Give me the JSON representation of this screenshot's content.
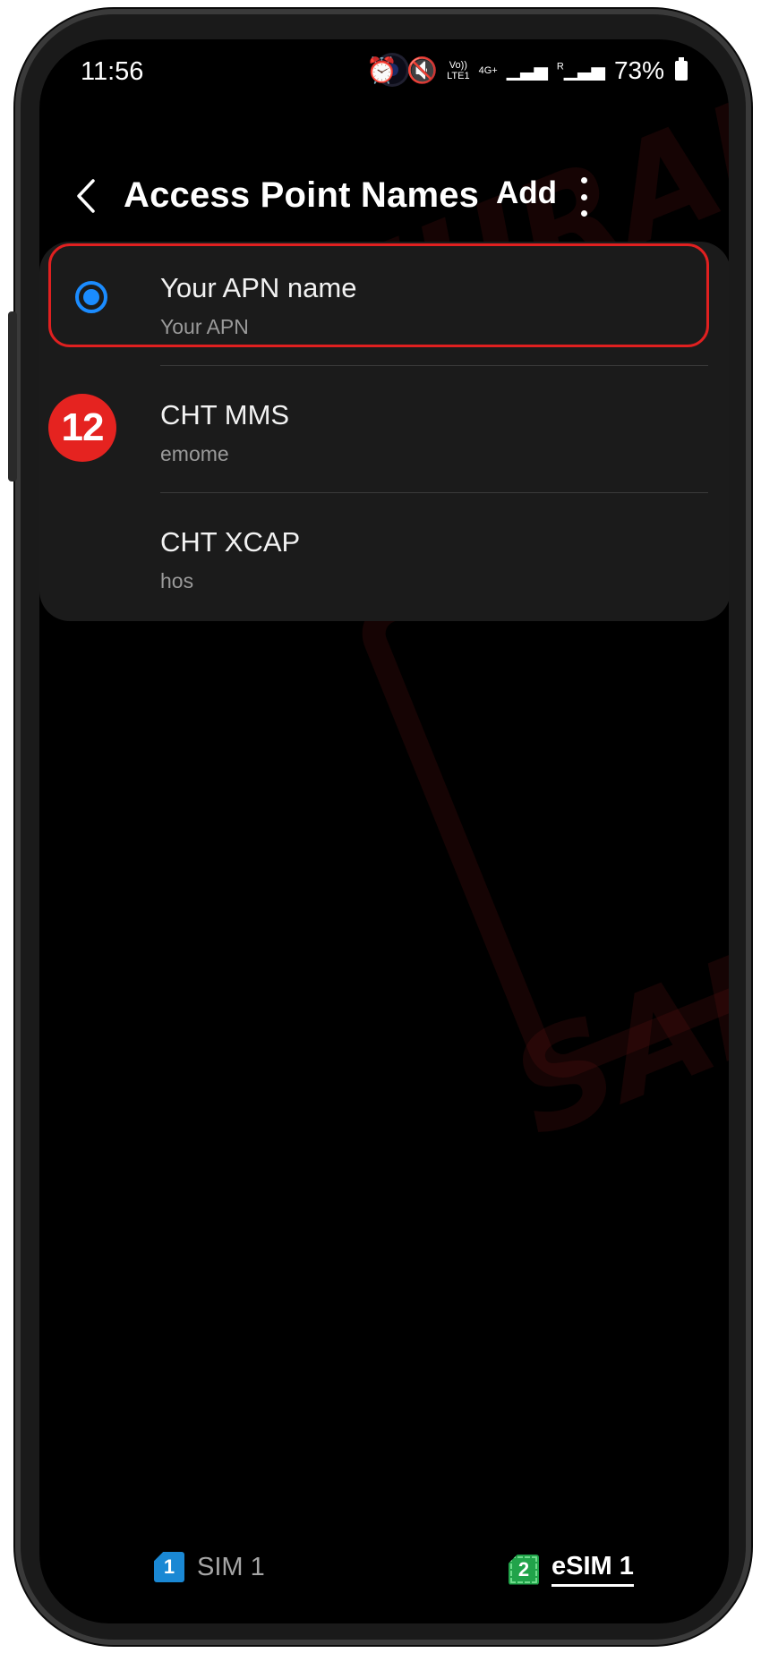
{
  "status_bar": {
    "time": "11:56",
    "volte": "Vo))\nLTE1",
    "network": "4G+",
    "roaming": "R",
    "battery": "73%"
  },
  "header": {
    "title": "Access Point Names",
    "add_label": "Add"
  },
  "apn_list": [
    {
      "name": "Your APN name",
      "apn": "Your APN",
      "selected": true
    },
    {
      "name": "CHT MMS",
      "apn": "emome",
      "selected": false
    },
    {
      "name": "CHT XCAP",
      "apn": "hos",
      "selected": false
    }
  ],
  "step_badge": "12",
  "watermark": "SAMURAISIM",
  "sim_tabs": [
    {
      "number": "1",
      "label": "SIM 1",
      "active": false
    },
    {
      "number": "2",
      "label": "eSIM 1",
      "active": true
    }
  ],
  "colors": {
    "accent": "#1b8cff",
    "highlight": "#e02020",
    "badge": "#e52320",
    "sim1": "#1a88d4",
    "sim2": "#21a34a"
  }
}
